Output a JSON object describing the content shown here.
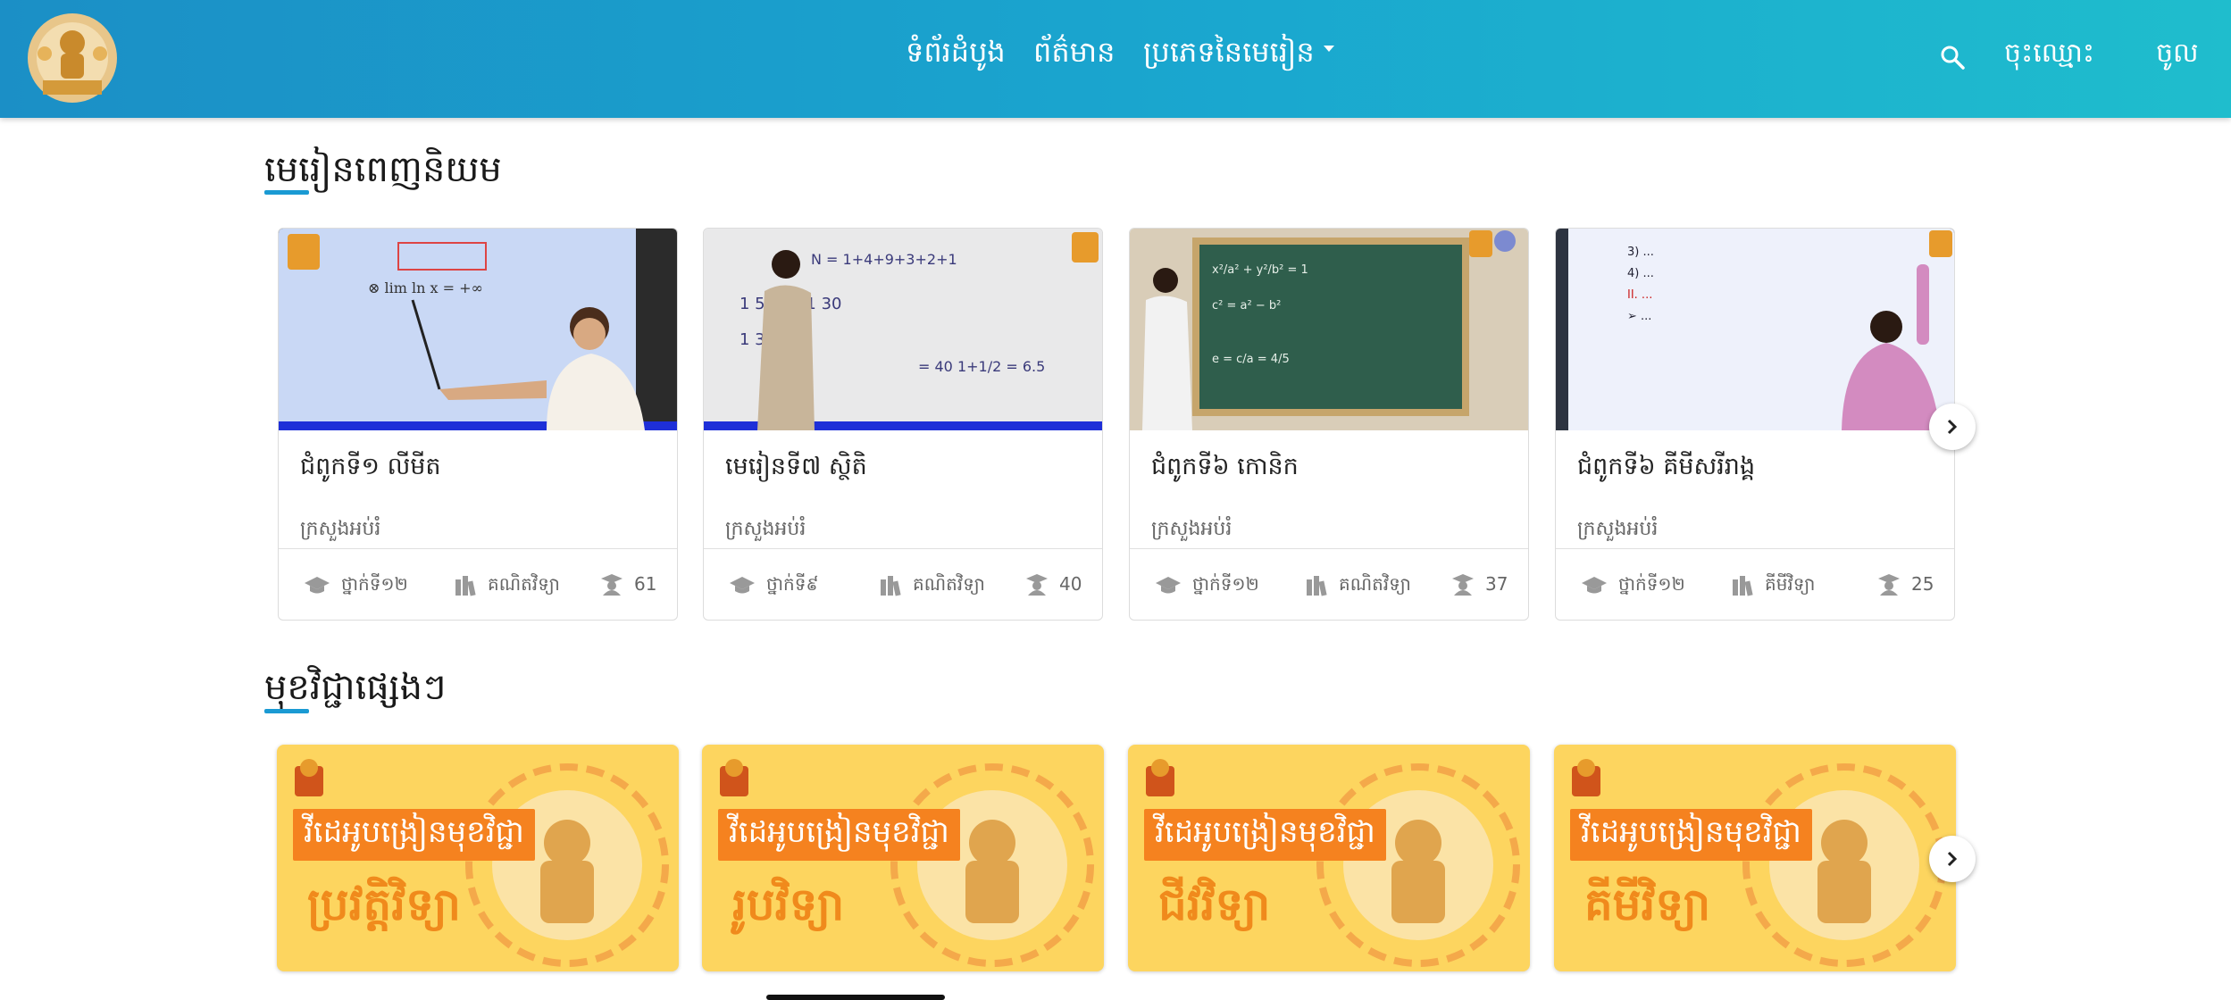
{
  "nav": {
    "home": "ទំព័រដំបូង",
    "news": "ព័ត៌មាន",
    "lesson_types": "ប្រភេទនៃមេរៀន",
    "register": "ចុះឈ្មោះ",
    "login": "ចូល"
  },
  "popular": {
    "title": "មេរៀនពេញនិយម",
    "cards": [
      {
        "title": "ជំពូកទី១ លីមីត",
        "author": "ក្រសួងអប់រំ",
        "grade": "ថ្នាក់ទី១២",
        "subject": "គណិតវិទ្យា",
        "count": "61"
      },
      {
        "title": "មេរៀនទី៧ ស្ថិតិ",
        "author": "ក្រសួងអប់រំ",
        "grade": "ថ្នាក់ទី៩",
        "subject": "គណិតវិទ្យា",
        "count": "40"
      },
      {
        "title": "ជំពូកទី៦ កោនិក",
        "author": "ក្រសួងអប់រំ",
        "grade": "ថ្នាក់ទី១២",
        "subject": "គណិតវិទ្យា",
        "count": "37"
      },
      {
        "title": "ជំពូកទី៦ គីមីសរីរាង្គ",
        "author": "ក្រសួងអប់រំ",
        "grade": "ថ្នាក់ទី១២",
        "subject": "គីមីវិទ្យា",
        "count": "25"
      }
    ]
  },
  "subjects": {
    "title": "មុខវិជ្ជាផ្សេងៗ",
    "cards": [
      {
        "banner": "វីដេអូបង្រៀនមុខវិជ្ជា",
        "name": "ប្រវត្តិវិទ្យា"
      },
      {
        "banner": "វីដេអូបង្រៀនមុខវិជ្ជា",
        "name": "រូបវិទ្យា"
      },
      {
        "banner": "វីដេអូបង្រៀនមុខវិជ្ជា",
        "name": "ជីវវិទ្យា"
      },
      {
        "banner": "វីដេអូបង្រៀនមុខវិជ្ជា",
        "name": "គីមីវិទ្យា"
      }
    ]
  },
  "icons": {
    "search": "search-icon",
    "grade": "graduation-cap-icon",
    "subject": "books-icon",
    "count": "student-icon",
    "next": "chevron-right-icon"
  },
  "colors": {
    "header_start": "#1b8fc6",
    "header_end": "#1fbdcd",
    "accent_underline": "#1a9ad3",
    "subject_bg": "#fdd55f",
    "subject_banner": "#f5821f"
  }
}
